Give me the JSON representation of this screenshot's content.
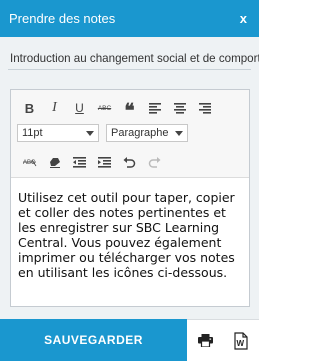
{
  "window": {
    "title": "Prendre des notes",
    "close_label": "x"
  },
  "subject": {
    "value": "Introduction au changement social et de comporte"
  },
  "toolbar": {
    "row1": [
      "bold-icon",
      "italic-icon",
      "underline-icon",
      "strikethrough-icon",
      "blockquote-icon",
      "align-left-icon",
      "align-center-icon",
      "align-right-icon"
    ],
    "bold_label": "B",
    "italic_label": "I",
    "underline_label": "U",
    "strike_label": "ABC",
    "quote_label": "❝",
    "font_size": "11pt",
    "block_format": "Paragraphe",
    "row3": [
      "clear-formatting-icon",
      "eraser-icon",
      "outdent-icon",
      "indent-icon",
      "undo-icon",
      "redo-icon"
    ]
  },
  "editor": {
    "content": "Utilisez cet outil pour taper, copier et coller des notes pertinentes et les enregistrer sur SBC Learning Central. Vous pouvez également imprimer ou télécharger vos notes en utilisant les icônes ci-dessous."
  },
  "footer": {
    "save_label": "SAUVEGARDER",
    "icons": [
      "print-icon",
      "word-download-icon"
    ]
  },
  "colors": {
    "accent": "#1a97cf",
    "panel_bg": "#eef2f4"
  }
}
